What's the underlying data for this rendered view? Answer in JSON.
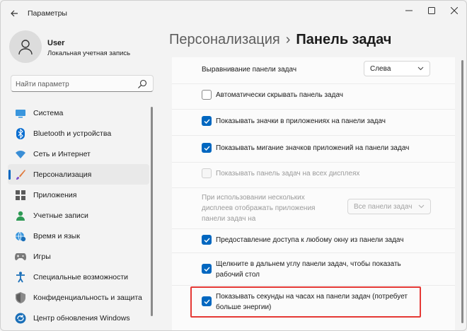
{
  "window": {
    "title": "Параметры",
    "back_icon": "arrow-left-icon",
    "minimize_icon": "minimize-icon",
    "maximize_icon": "maximize-icon",
    "close_icon": "close-icon"
  },
  "profile": {
    "name": "User",
    "subtitle": "Локальная учетная запись"
  },
  "search": {
    "placeholder": "Найти параметр"
  },
  "sidebar": {
    "items": [
      {
        "label": "Система",
        "icon": "monitor-icon"
      },
      {
        "label": "Bluetooth и устройства",
        "icon": "bluetooth-icon"
      },
      {
        "label": "Сеть и Интернет",
        "icon": "wifi-icon"
      },
      {
        "label": "Персонализация",
        "icon": "brush-icon",
        "active": true
      },
      {
        "label": "Приложения",
        "icon": "apps-icon"
      },
      {
        "label": "Учетные записи",
        "icon": "person-icon"
      },
      {
        "label": "Время и язык",
        "icon": "globe-clock-icon"
      },
      {
        "label": "Игры",
        "icon": "gamepad-icon"
      },
      {
        "label": "Специальные возможности",
        "icon": "accessibility-icon"
      },
      {
        "label": "Конфиденциальность и защита",
        "icon": "shield-icon"
      },
      {
        "label": "Центр обновления Windows",
        "icon": "update-icon"
      }
    ]
  },
  "header": {
    "parent": "Персонализация",
    "separator": "›",
    "current": "Панель задач"
  },
  "settings": {
    "alignment": {
      "label": "Выравнивание панели задач",
      "value": "Слева"
    },
    "autohide": {
      "label": "Автоматически скрывать панель задач",
      "checked": false
    },
    "badges": {
      "label": "Показывать значки в приложениях на панели задач",
      "checked": true
    },
    "flashing": {
      "label": "Показывать мигание значков приложений на панели задач",
      "checked": true
    },
    "all_displays": {
      "label": "Показывать панель задач на всех дисплеях",
      "checked": false,
      "disabled": true
    },
    "multi_display": {
      "label_line1": "При использовании нескольких",
      "label_line2": "дисплеев отображать приложения",
      "label_line3": "панели задач на",
      "value": "Все панели задач",
      "disabled": true
    },
    "share_window": {
      "label": "Предоставление доступа к любому окну из панели задач",
      "checked": true
    },
    "far_corner": {
      "label_line1": "Щелкните в дальнем углу панели задач, чтобы показать",
      "label_line2": "рабочий стол",
      "checked": true
    },
    "seconds": {
      "label_line1": "Показывать секунды на часах на панели задач (потребует",
      "label_line2": "больше энергии)",
      "checked": true
    }
  },
  "colors": {
    "accent": "#0067c0",
    "highlight": "#e53935"
  }
}
